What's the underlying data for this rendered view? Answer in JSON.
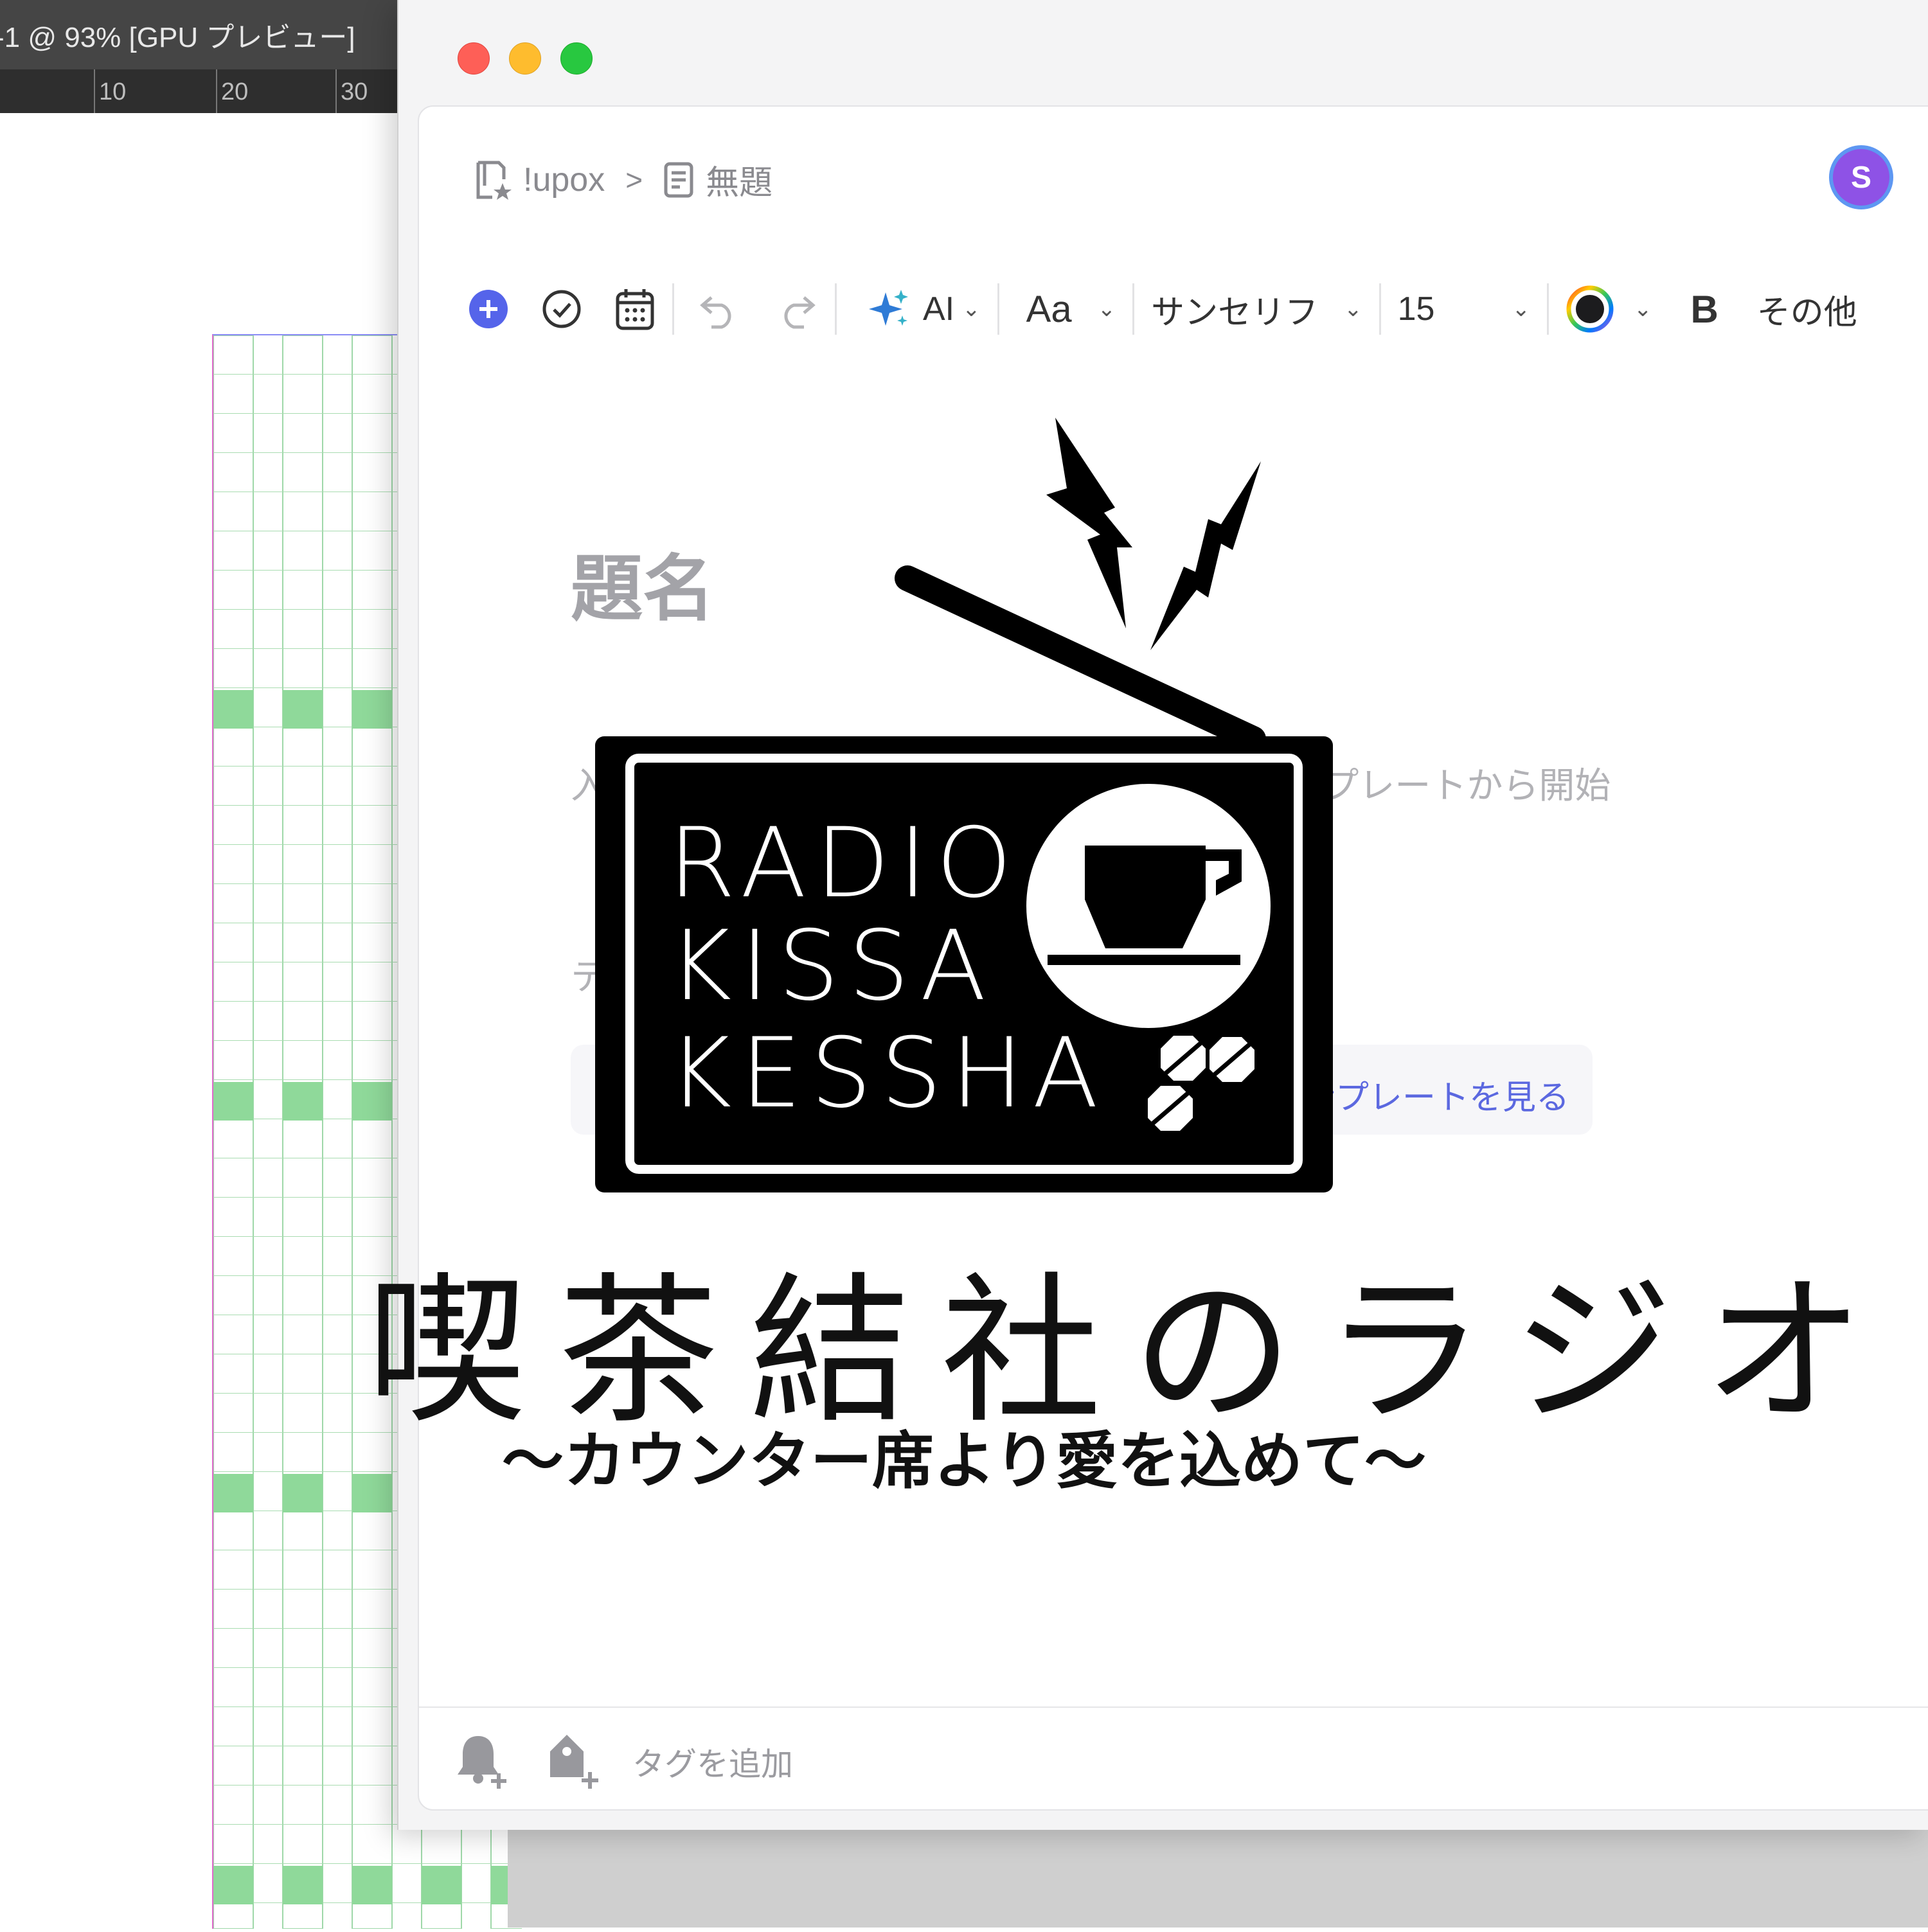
{
  "background_app": {
    "title": "-1 @ 93% [GPU プレビュー]",
    "ruler_ticks": [
      "10",
      "20",
      "30"
    ]
  },
  "window": {
    "breadcrumb": {
      "workspace": "!upox",
      "separator": ">",
      "page": "無題"
    },
    "avatar_initial": "S",
    "toolbar": {
      "ai_label": "AI",
      "text_style_label": "Aa",
      "font_label": "サンセリフ",
      "size_label": "15",
      "bold_label": "B",
      "more_label": "その他"
    },
    "editor": {
      "title_placeholder": "題名",
      "body_hint": "入力を開始、ファイルをドラッグ、またはテンプレートから開始",
      "templates_label": "テ",
      "more_templates_link": "さらに多くのテンプレートを見る"
    },
    "footer": {
      "tag_placeholder": "タグを追加"
    }
  },
  "logo": {
    "radio_lines": [
      "RADIO",
      "KISSA",
      "KESSHA"
    ],
    "title": "喫茶結社のラジオ",
    "subtitle": "〜カウンター席より愛を込めて〜"
  },
  "colors": {
    "close": "#fe5f57",
    "minimize": "#febc2e",
    "maximize": "#28c840",
    "accent": "#5b68e0",
    "avatar": "#8e52e6"
  },
  "icons": [
    "page-star-icon",
    "chevron-right-icon",
    "document-icon",
    "plus-circle-icon",
    "check-circle-icon",
    "calendar-icon",
    "undo-icon",
    "redo-icon",
    "sparkle-icon",
    "color-ring-icon",
    "bell-plus-icon",
    "tag-plus-icon"
  ]
}
